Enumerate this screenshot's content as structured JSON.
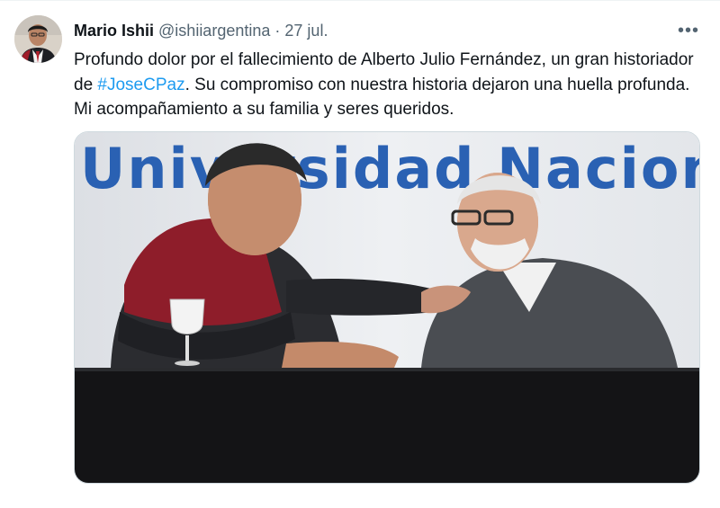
{
  "tweet": {
    "author_name": "Mario Ishii",
    "author_handle": "@ishiiargentina",
    "separator": "·",
    "date": "27 jul.",
    "more_label": "•••",
    "text_before": "Profundo dolor por el fallecimiento de Alberto Julio Fernández, un gran historiador de ",
    "hashtag": "#JoseCPaz",
    "text_after": ". Su compromiso con nuestra historia dejaron una huella profunda. Mi acompañamiento a su familia y seres queridos.",
    "photo_banner_text": "Universidad Nacional",
    "avatar_icon": "profile-photo",
    "colors": {
      "hashtag": "#1d9bf0",
      "secondary_text": "#536471",
      "banner_blue": "#2a61b3"
    }
  }
}
